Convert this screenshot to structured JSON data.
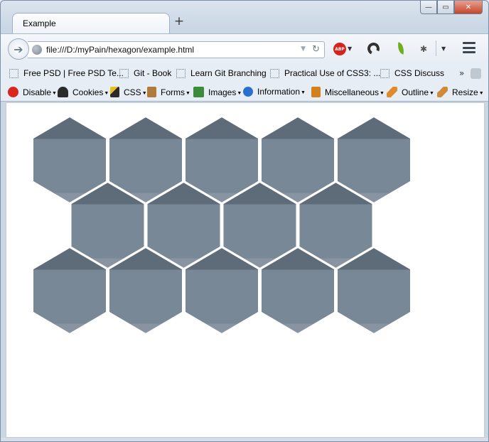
{
  "window": {
    "tab_title": "Example",
    "new_tab": "+",
    "controls": {
      "minimize": "—",
      "maximize": "▭",
      "close": "✕"
    }
  },
  "nav": {
    "url": "file:///D:/myPain/hexagon/example.html",
    "abp_label": "ABP"
  },
  "bookmarks": {
    "items": [
      {
        "label": "Free PSD | Free PSD Te..."
      },
      {
        "label": "Git - Book"
      },
      {
        "label": "Learn Git Branching"
      },
      {
        "label": "Practical Use of CSS3: ..."
      },
      {
        "label": "CSS Discuss"
      }
    ],
    "overflow": "»"
  },
  "devtoolbar": {
    "items": [
      {
        "label": "Disable",
        "icon": "disable-icon",
        "color": "#d9251d"
      },
      {
        "label": "Cookies",
        "icon": "cookies-icon",
        "color": "#2b2b2b"
      },
      {
        "label": "CSS",
        "icon": "css-wand-icon",
        "color": "#e8c020"
      },
      {
        "label": "Forms",
        "icon": "clipboard-icon",
        "color": "#b07a3a"
      },
      {
        "label": "Images",
        "icon": "image-icon",
        "color": "#3c8a3c"
      },
      {
        "label": "Information",
        "icon": "info-icon",
        "color": "#2a6fcf"
      },
      {
        "label": "Miscellaneous",
        "icon": "book-icon",
        "color": "#d4801c"
      },
      {
        "label": "Outline",
        "icon": "pencil-icon",
        "color": "#e08a2a"
      },
      {
        "label": "Resize",
        "icon": "ruler-icon",
        "color": "#d08b3a"
      }
    ]
  },
  "page": {
    "hex_rows": [
      5,
      4,
      5
    ],
    "colors": {
      "hex_top": "#5e6b79",
      "hex_mid": "#798896",
      "hex_bottom": "#8894a1",
      "background": "#ffffff"
    }
  }
}
